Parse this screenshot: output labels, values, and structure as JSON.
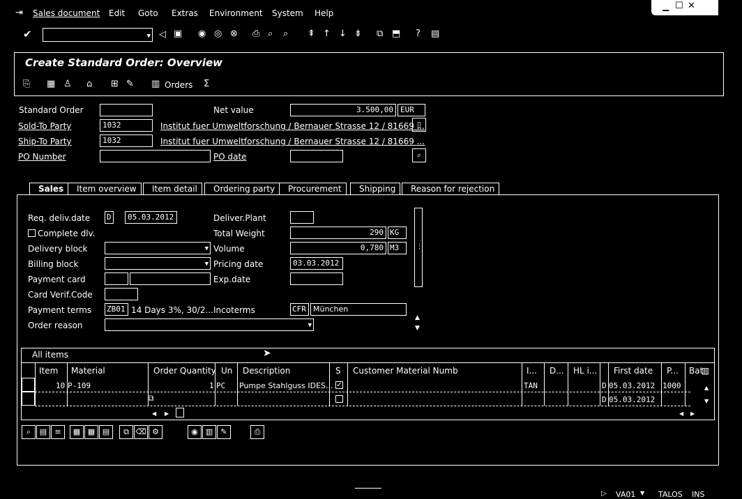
{
  "menu": {
    "items": [
      "Sales document",
      "Edit",
      "Goto",
      "Extras",
      "Environment",
      "System",
      "Help"
    ]
  },
  "window_controls": {
    "minimize": "▁",
    "maximize": "☐",
    "close": "✕"
  },
  "header": {
    "title": "Create Standard Order: Overview",
    "orders_label": "Orders"
  },
  "top_fields": {
    "standard_order_label": "Standard Order",
    "standard_order_value": "",
    "net_value_label": "Net value",
    "net_value": "3.500,00",
    "currency": "EUR",
    "sold_to_label": "Sold-To Party",
    "sold_to_value": "1032",
    "sold_to_text": "Institut fuer Umweltforschung / Bernauer Strasse 12 / 81669 ...",
    "ship_to_label": "Ship-To Party",
    "ship_to_value": "1032",
    "ship_to_text": "Institut fuer Umweltforschung / Bernauer Strasse 12 / 81669 ...",
    "po_number_label": "PO Number",
    "po_number_value": "",
    "po_date_label": "PO date",
    "po_date_value": ""
  },
  "tabs": [
    "Sales",
    "Item overview",
    "Item detail",
    "Ordering party",
    "Procurement",
    "Shipping",
    "Reason for rejection"
  ],
  "sales": {
    "req_deliv_label": "Req. deliv.date",
    "req_deliv_type": "D",
    "req_deliv_date": "05.03.2012",
    "deliver_plant_label": "Deliver.Plant",
    "deliver_plant_value": "",
    "complete_dlv_label": "Complete dlv.",
    "total_weight_label": "Total Weight",
    "total_weight_value": "290",
    "weight_unit": "KG",
    "delivery_block_label": "Delivery block",
    "volume_label": "Volume",
    "volume_value": "0,780",
    "volume_unit": "M3",
    "billing_block_label": "Billing block",
    "pricing_date_label": "Pricing date",
    "pricing_date_value": "03.03.2012",
    "payment_card_label": "Payment card",
    "exp_date_label": "Exp.date",
    "card_verif_label": "Card Verif.Code",
    "payment_terms_label": "Payment terms",
    "payment_terms_code": "ZB01",
    "payment_terms_text": "14 Days 3%, 30/2...",
    "incoterms_label": "Incoterms",
    "incoterms_code": "CFR",
    "incoterms_place": "München",
    "order_reason_label": "Order reason"
  },
  "items": {
    "title": "All items",
    "columns": [
      "Item",
      "Material",
      "Order Quantity",
      "Un",
      "Description",
      "S",
      "Customer Material Numb",
      "I...",
      "D...",
      "HL i...",
      "First date",
      "P...",
      "Bat"
    ],
    "rows": [
      {
        "item": "10",
        "material": "P-109",
        "qty": "1",
        "un": "PC",
        "desc": "Pumpe Stahlguss IDES...",
        "checked": true,
        "itca": "TAN",
        "d": "D",
        "first_date": "05.03.2012",
        "plant": "1000"
      },
      {
        "item": "",
        "material": "",
        "qty": "",
        "un": "",
        "desc": "",
        "checked": false,
        "itca": "",
        "d": "D",
        "first_date": "05.03.2012",
        "plant": ""
      }
    ]
  },
  "status": {
    "transaction": "VA01",
    "server": "TALOS",
    "mode": "INS"
  }
}
